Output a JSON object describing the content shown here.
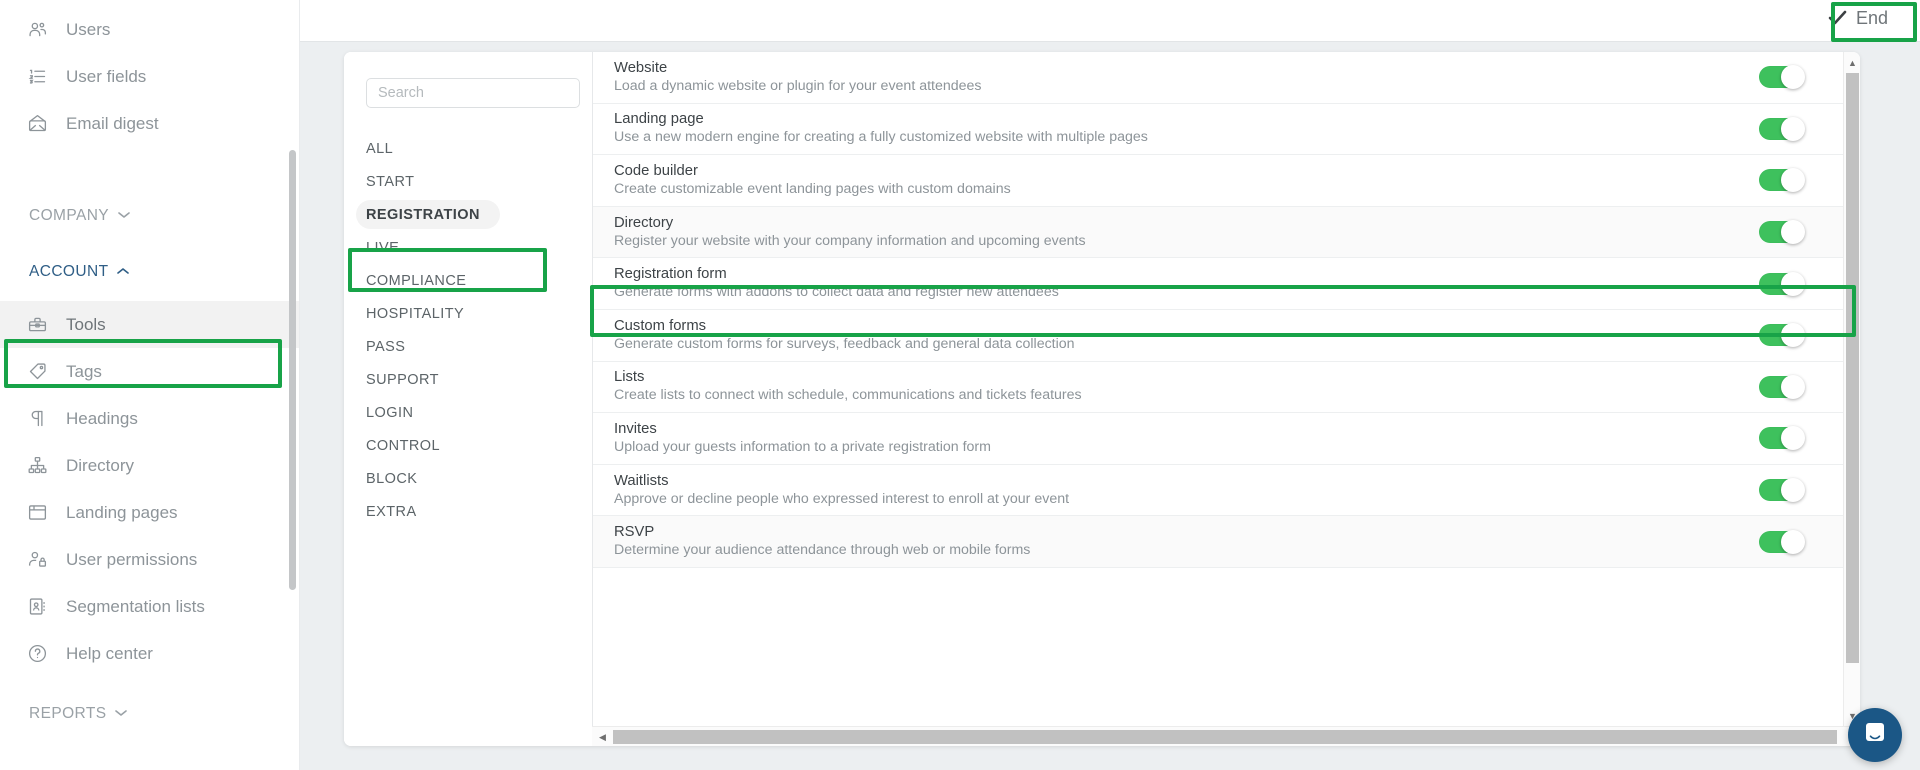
{
  "sidebar": {
    "items_top": [
      {
        "label": "Users",
        "icon": "users-icon"
      },
      {
        "label": "User fields",
        "icon": "list-numbered-icon"
      },
      {
        "label": "Email digest",
        "icon": "email-icon"
      }
    ],
    "groups": [
      {
        "label": "COMPANY",
        "caret": "⌄",
        "expanded": false
      },
      {
        "label": "ACCOUNT",
        "caret": "⌃",
        "expanded": true
      }
    ],
    "account_items": [
      {
        "label": "Tools",
        "icon": "toolbox-icon",
        "active": true
      },
      {
        "label": "Tags",
        "icon": "tag-icon",
        "active": false
      },
      {
        "label": "Headings",
        "icon": "paragraph-icon",
        "active": false
      },
      {
        "label": "Directory",
        "icon": "sitemap-icon",
        "active": false
      },
      {
        "label": "Landing pages",
        "icon": "window-icon",
        "active": false
      },
      {
        "label": "User permissions",
        "icon": "user-lock-icon",
        "active": false
      },
      {
        "label": "Segmentation lists",
        "icon": "id-card-icon",
        "active": false
      },
      {
        "label": "Help center",
        "icon": "question-circle-icon",
        "active": false
      }
    ],
    "reports_group": {
      "label": "REPORTS",
      "caret": "⌄"
    }
  },
  "topbar": {
    "end_label": "End",
    "end_icon": "check-icon"
  },
  "search": {
    "placeholder": "Search",
    "value": ""
  },
  "categories": [
    {
      "label": "ALL",
      "active": false
    },
    {
      "label": "START",
      "active": false
    },
    {
      "label": "REGISTRATION",
      "active": true
    },
    {
      "label": "LIVE",
      "active": false
    },
    {
      "label": "COMPLIANCE",
      "active": false
    },
    {
      "label": "HOSPITALITY",
      "active": false
    },
    {
      "label": "PASS",
      "active": false
    },
    {
      "label": "SUPPORT",
      "active": false
    },
    {
      "label": "LOGIN",
      "active": false
    },
    {
      "label": "CONTROL",
      "active": false
    },
    {
      "label": "BLOCK",
      "active": false
    },
    {
      "label": "EXTRA",
      "active": false
    }
  ],
  "features": [
    {
      "title": "Website",
      "desc": "Load a dynamic website or plugin for your event attendees",
      "enabled": true,
      "highlighted": false
    },
    {
      "title": "Landing page",
      "desc": "Use a new modern engine for creating a fully customized website with multiple pages",
      "enabled": true,
      "highlighted": false
    },
    {
      "title": "Code builder",
      "desc": "Create customizable event landing pages with custom domains",
      "enabled": true,
      "highlighted": false
    },
    {
      "title": "Directory",
      "desc": "Register your website with your company information and upcoming events",
      "enabled": true,
      "highlighted": true
    },
    {
      "title": "Registration form",
      "desc": "Generate forms with addons to collect data and register new attendees",
      "enabled": true,
      "highlighted": false
    },
    {
      "title": "Custom forms",
      "desc": "Generate custom forms for surveys, feedback and general data collection",
      "enabled": true,
      "highlighted": false
    },
    {
      "title": "Lists",
      "desc": "Create lists to connect with schedule, communications and tickets features",
      "enabled": true,
      "highlighted": false
    },
    {
      "title": "Invites",
      "desc": "Upload your guests information to a private registration form",
      "enabled": true,
      "highlighted": false
    },
    {
      "title": "Waitlists",
      "desc": "Approve or decline people who expressed interest to enroll at your event",
      "enabled": true,
      "highlighted": false
    },
    {
      "title": "RSVP",
      "desc": "Determine your audience attendance through web or mobile forms",
      "enabled": true,
      "highlighted": false
    }
  ],
  "colors": {
    "accent_green": "#18a348",
    "toggle_on": "#3ec15d",
    "account_blue": "#2f5e86",
    "intercom_blue": "#1b5786"
  },
  "scrollbars": {
    "vertical_up": "▲",
    "vertical_down": "▼",
    "horizontal_left": "◀"
  },
  "intercom": {
    "icon": "messenger-icon"
  }
}
